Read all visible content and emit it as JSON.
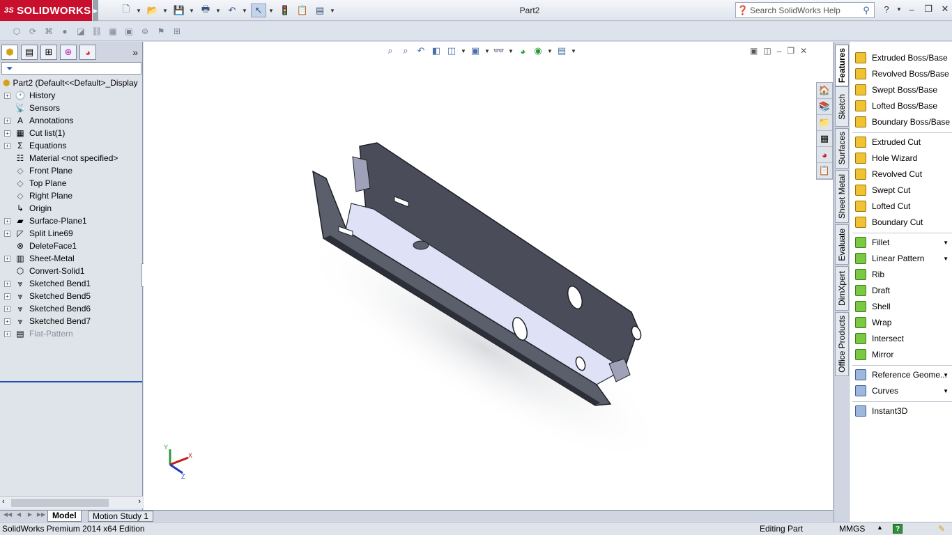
{
  "app": {
    "brand_prefix": "3S",
    "brand": "SOLIDWORKS",
    "doc_title": "Part2",
    "search_placeholder": "Search SolidWorks Help"
  },
  "feature_tree": {
    "root_label": "Part2  (Default<<Default>_Display",
    "items": [
      {
        "label": "History",
        "icon": "history-icon",
        "expandable": true
      },
      {
        "label": "Sensors",
        "icon": "sensors-icon",
        "expandable": false
      },
      {
        "label": "Annotations",
        "icon": "annotations-icon",
        "expandable": true
      },
      {
        "label": "Cut list(1)",
        "icon": "cut-list-icon",
        "expandable": true
      },
      {
        "label": "Equations",
        "icon": "equations-icon",
        "expandable": true
      },
      {
        "label": "Material <not specified>",
        "icon": "material-icon",
        "expandable": false
      },
      {
        "label": "Front Plane",
        "icon": "plane-icon",
        "expandable": false
      },
      {
        "label": "Top Plane",
        "icon": "plane-icon",
        "expandable": false
      },
      {
        "label": "Right Plane",
        "icon": "plane-icon",
        "expandable": false
      },
      {
        "label": "Origin",
        "icon": "origin-icon",
        "expandable": false
      },
      {
        "label": "Surface-Plane1",
        "icon": "surface-icon",
        "expandable": true
      },
      {
        "label": "Split Line69",
        "icon": "split-line-icon",
        "expandable": true
      },
      {
        "label": "DeleteFace1",
        "icon": "delete-face-icon",
        "expandable": false
      },
      {
        "label": "Sheet-Metal",
        "icon": "sheet-metal-icon",
        "expandable": true
      },
      {
        "label": "Convert-Solid1",
        "icon": "convert-solid-icon",
        "expandable": false
      },
      {
        "label": "Sketched Bend1",
        "icon": "sketched-bend-icon",
        "expandable": true
      },
      {
        "label": "Sketched Bend5",
        "icon": "sketched-bend-icon",
        "expandable": true
      },
      {
        "label": "Sketched Bend6",
        "icon": "sketched-bend-icon",
        "expandable": true
      },
      {
        "label": "Sketched Bend7",
        "icon": "sketched-bend-icon",
        "expandable": true
      },
      {
        "label": "Flat-Pattern",
        "icon": "flat-pattern-icon",
        "expandable": true,
        "suppressed": true
      }
    ]
  },
  "command_manager": {
    "tabs": [
      "Features",
      "Sketch",
      "Surfaces",
      "Sheet Metal",
      "Evaluate",
      "DimXpert",
      "Office Products"
    ],
    "active_tab": "Features",
    "groups": [
      [
        "Extruded Boss/Base",
        "Revolved Boss/Base",
        "Swept Boss/Base",
        "Lofted Boss/Base",
        "Boundary Boss/Base"
      ],
      [
        "Extruded Cut",
        "Hole Wizard",
        "Revolved Cut",
        "Swept Cut",
        "Lofted Cut",
        "Boundary Cut"
      ],
      [
        "Fillet",
        "Linear Pattern",
        "Rib",
        "Draft",
        "Shell",
        "Wrap",
        "Intersect",
        "Mirror"
      ],
      [
        "Reference Geome...",
        "Curves"
      ],
      [
        "Instant3D"
      ]
    ]
  },
  "bottom_tabs": [
    "Model",
    "Motion Study 1"
  ],
  "status": {
    "edition": "SolidWorks Premium 2014 x64 Edition",
    "mode": "Editing Part",
    "units": "MMGS",
    "help_glyph": "?"
  },
  "triad": {
    "x": "X",
    "y": "Y",
    "z": "Z"
  }
}
